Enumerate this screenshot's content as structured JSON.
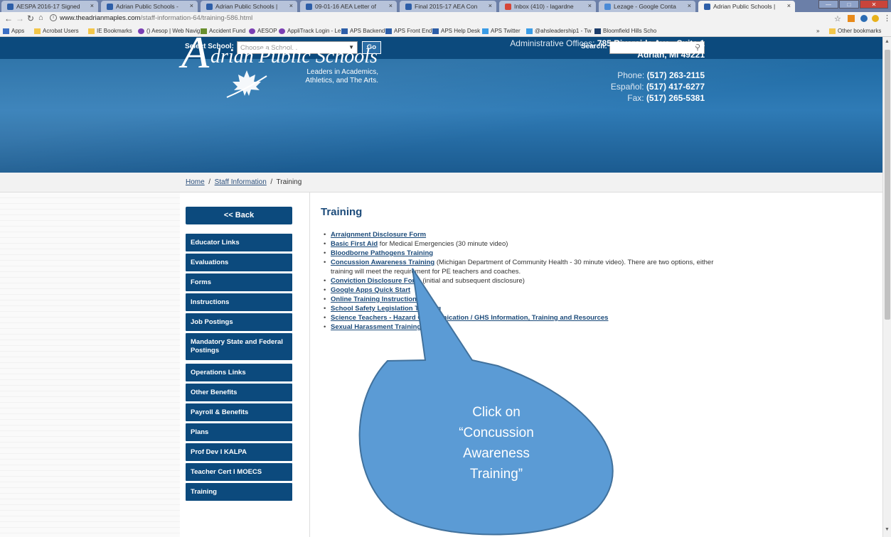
{
  "browser": {
    "tabs": [
      {
        "title": "AESPA 2016-17 Signed",
        "active": false
      },
      {
        "title": "Adrian Public Schools -",
        "active": false
      },
      {
        "title": "Adrian Public Schools |",
        "active": false
      },
      {
        "title": "09-01-16 AEA Letter of",
        "active": false
      },
      {
        "title": "Final 2015-17 AEA Con",
        "active": false
      },
      {
        "title": "Inbox (410) - lagardne",
        "active": false
      },
      {
        "title": "Lezage - Google Conta",
        "active": false
      },
      {
        "title": "Adrian Public Schools |",
        "active": true
      }
    ],
    "tab_close": "×",
    "url_host": "www.theadrianmaples.com",
    "url_path": "/staff-information-64/training-586.html",
    "bookmarks": [
      "Apps",
      "Acrobat Users",
      "IE Bookmarks",
      "() Aesop | Web Navig",
      "Accident Fund",
      "AESOP",
      "AppliTrack Login - Le",
      "APS Backend",
      "APS Front End",
      "APS Help Desk",
      "APS Twitter",
      "@ahsleadership1 - Tw",
      "Bloomfield Hills Scho"
    ],
    "more_bookmarks": "»",
    "other_bookmarks": "Other bookmarks"
  },
  "topbar": {
    "select_label": "Select School:",
    "select_value": "Choose a School...",
    "go_label": "Go",
    "search_label": "Search:"
  },
  "header": {
    "logo_initial": "A",
    "logo_name": "drian Public Schools",
    "tagline_1": "Leaders in Academics,",
    "tagline_2": "Athletics, and The Arts.",
    "office_label": "Administrative Offices:",
    "office_addr_1": "785 Riverside Ave., Suite 1",
    "office_addr_2": "Adrian, MI 49221",
    "phone_label": "Phone:",
    "phone": "(517) 263-2115",
    "espanol_label": "Español:",
    "espanol": "(517) 417-6277",
    "fax_label": "Fax:",
    "fax": "(517) 265-5381"
  },
  "breadcrumb": {
    "home": "Home",
    "sep": "/",
    "staff": "Staff Information",
    "current": "Training"
  },
  "sidebar": {
    "back": "<< Back",
    "items": [
      "Educator Links",
      "Evaluations",
      "Forms",
      "Instructions",
      "Job Postings",
      "Mandatory State and Federal Postings",
      "Operations Links",
      "Other Benefits",
      "Payroll & Benefits",
      "Plans",
      "Prof Dev I KALPA",
      "Teacher Cert I MOECS",
      "Training"
    ]
  },
  "main": {
    "title": "Training",
    "links": [
      {
        "link": "Arraignment Disclosure Form",
        "rest": ""
      },
      {
        "link": "Basic First Aid",
        "rest": " for Medical Emergencies (30 minute video)"
      },
      {
        "link": "Bloodborne Pathogens Training",
        "rest": ""
      },
      {
        "link": "Concussion Awareness Training",
        "rest": " (Michigan Department of Community Health - 30 minute video). There are two options, either training will meet the requirement for PE teachers and coaches."
      },
      {
        "link": "Conviction Disclosure Form",
        "rest": " (initial and subsequent disclosure)"
      },
      {
        "link": "Google Apps Quick Start",
        "rest": ""
      },
      {
        "link": "Online Training Instructions",
        "rest": ""
      },
      {
        "link": "School Safety Legislation Training",
        "rest": ""
      },
      {
        "link": "Science Teachers - Hazard Communication / GHS Information, Training and Resources",
        "rest": ""
      },
      {
        "link": "Sexual Harassment Training",
        "rest": ""
      }
    ]
  },
  "callout": {
    "line_1": "Click on",
    "line_2": "“Concussion",
    "line_3": "Awareness",
    "line_4": "Training”"
  },
  "colors": {
    "nav_blue": "#0c4a7d",
    "banner_blue": "#2f7bb6",
    "link_blue": "#1c4b7a",
    "callout_fill": "#5b9bd5",
    "callout_stroke": "#41719c"
  }
}
